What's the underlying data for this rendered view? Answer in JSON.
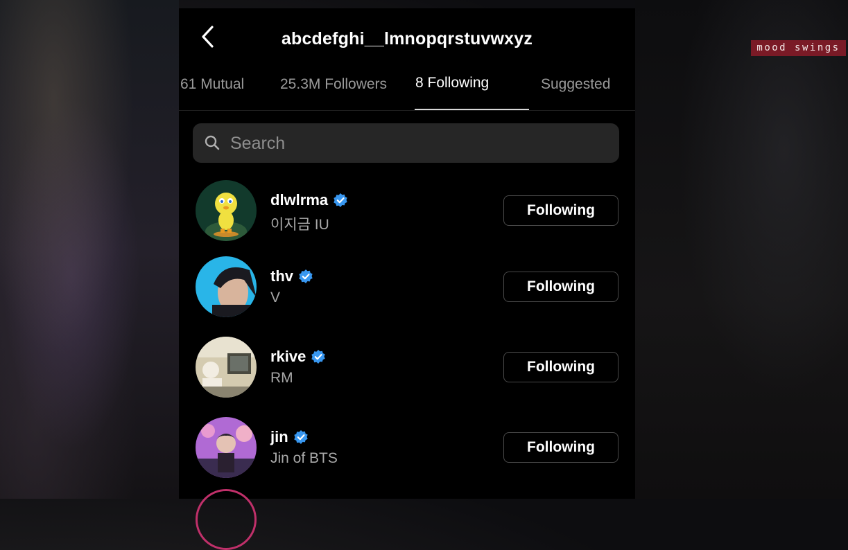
{
  "header": {
    "title": "abcdefghi__lmnopqrstuvwxyz",
    "back_icon": "chevron-left-icon"
  },
  "tabs": [
    {
      "label": "61 Mutual",
      "active": false
    },
    {
      "label": "25.3M Followers",
      "active": false
    },
    {
      "label": "8 Following",
      "active": true
    },
    {
      "label": "Suggested",
      "active": false
    }
  ],
  "search": {
    "placeholder": "Search",
    "value": "",
    "icon": "search-icon"
  },
  "users": [
    {
      "username": "dlwlrma",
      "full_name": "이지금 IU",
      "verified": true,
      "button": "Following",
      "avatar_colors": [
        "#0f3a2c",
        "#2f6e4a",
        "#e8d83a"
      ]
    },
    {
      "username": "thv",
      "full_name": "V",
      "verified": true,
      "button": "Following",
      "avatar_colors": [
        "#29b5e8",
        "#1c1c22",
        "#d9b7a0"
      ]
    },
    {
      "username": "rkive",
      "full_name": "RM",
      "verified": true,
      "button": "Following",
      "avatar_colors": [
        "#cfc7a8",
        "#4a4a42",
        "#e6e0d0"
      ]
    },
    {
      "username": "jin",
      "full_name": "Jin of BTS",
      "verified": true,
      "button": "Following",
      "avatar_colors": [
        "#b76fd6",
        "#2c2c4a",
        "#e6c0b8"
      ]
    }
  ],
  "colors": {
    "verified_blue": "#3897f0",
    "watermark_bg": "#7a1a26"
  },
  "watermark": {
    "text": "mood swings"
  }
}
